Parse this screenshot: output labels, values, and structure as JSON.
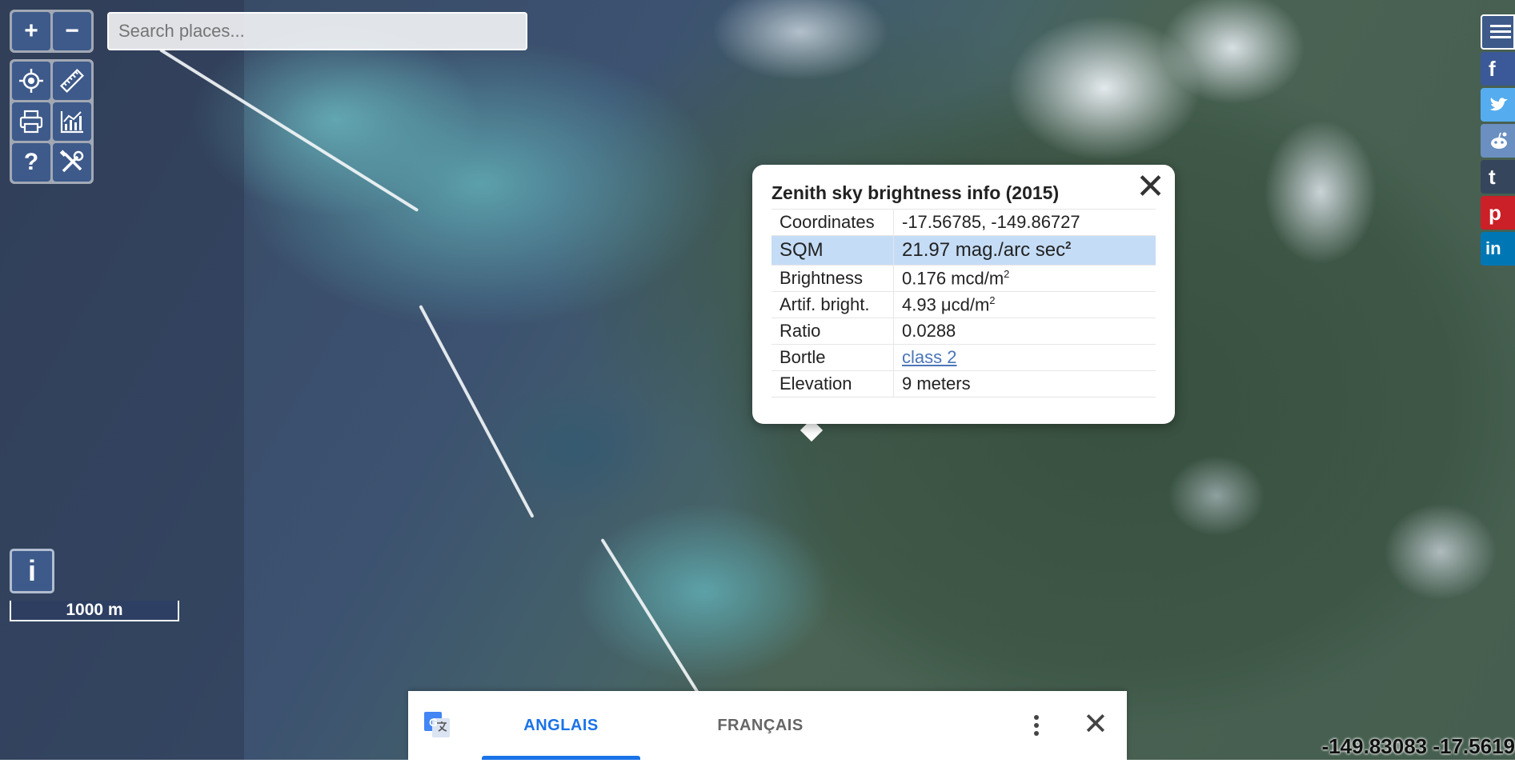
{
  "toolbar": {
    "zoom_in_label": "+",
    "zoom_out_label": "−",
    "help_label": "?",
    "info_label": "i"
  },
  "search": {
    "placeholder": "Search places..."
  },
  "scale_bar": {
    "label": "1000 m"
  },
  "popup": {
    "title": "Zenith sky brightness info (2015)",
    "close_label": "✕",
    "rows": [
      {
        "key": "Coordinates",
        "value": "-17.56785, -149.86727"
      },
      {
        "key": "SQM",
        "value": "21.97 mag./arc sec",
        "sup": "2"
      },
      {
        "key": "Brightness",
        "value": "0.176 mcd/m",
        "sup": "2"
      },
      {
        "key": "Artif. bright.",
        "value": "4.93 μcd/m",
        "sup": "2"
      },
      {
        "key": "Ratio",
        "value": "0.0288"
      },
      {
        "key": "Bortle",
        "value": "class 2"
      },
      {
        "key": "Elevation",
        "value": "9 meters"
      }
    ]
  },
  "share": {
    "facebook": "f",
    "tumblr": "t",
    "pinterest": "p",
    "linkedin": "in",
    "colors": {
      "menu": "#3d5a8a",
      "facebook": "#3b5998",
      "twitter": "#55acee",
      "reddit": "#6a8fc0",
      "tumblr": "#35465c",
      "pinterest": "#cb2027",
      "linkedin": "#0077b5"
    }
  },
  "translate_bar": {
    "tab_source": "ANGLAIS",
    "tab_target": "FRANÇAIS",
    "close_label": "✕",
    "accent_color": "#1a73e8"
  },
  "coords_readout": "-149.83083 -17.5619"
}
